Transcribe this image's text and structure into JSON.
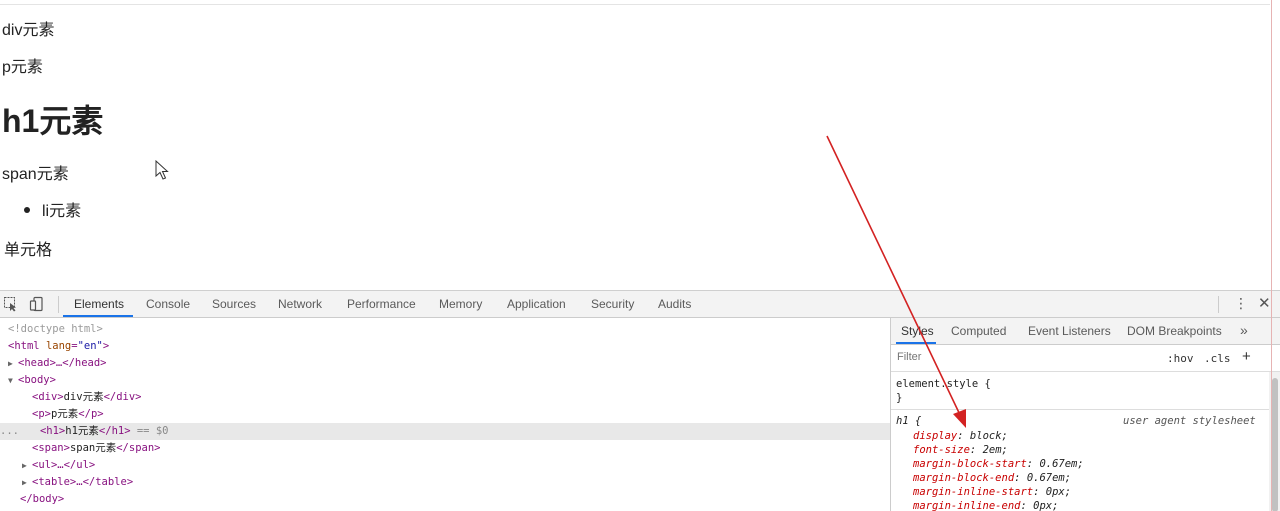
{
  "page": {
    "div_text": "div元素",
    "p_text": "p元素",
    "h1_text": "h1元素",
    "span_text": "span元素",
    "li_text": "li元素",
    "td_text": "单元格"
  },
  "devtools": {
    "tabs": [
      "Elements",
      "Console",
      "Sources",
      "Network",
      "Performance",
      "Memory",
      "Application",
      "Security",
      "Audits"
    ],
    "active_tab": "Elements",
    "dom": {
      "doctype": "<!doctype html>",
      "html_open_tag": "html",
      "html_attr": "lang",
      "html_attr_val": "\"en\"",
      "head": "<head>…</head>",
      "body_open": "<body>",
      "div_tag_open": "<div>",
      "div_text": "div元素",
      "div_tag_close": "</div>",
      "p_tag_open": "<p>",
      "p_text": "p元素",
      "p_tag_close": "</p>",
      "h1_tag_open": "<h1>",
      "h1_text": "h1元素",
      "h1_tag_close": "</h1>",
      "h1_marker": " == $0",
      "span_tag_open": "<span>",
      "span_text": "span元素",
      "span_tag_close": "</span>",
      "ul": "<ul>…</ul>",
      "table": "<table>…</table>",
      "body_close": "</body>",
      "ellipsis_marker": "..."
    },
    "styles_tabs": [
      "Styles",
      "Computed",
      "Event Listeners",
      "DOM Breakpoints"
    ],
    "styles_more": "»",
    "filter_placeholder": "Filter",
    "hov_label": ":hov",
    "cls_label": ".cls",
    "plus_label": "+",
    "element_style_open": "element.style {",
    "element_style_close": "}",
    "h1_selector": "h1 {",
    "ua_label": "user agent stylesheet",
    "declarations": [
      {
        "prop": "display",
        "value": "block;"
      },
      {
        "prop": "font-size",
        "value": "2em;"
      },
      {
        "prop": "margin-block-start",
        "value": "0.67em;"
      },
      {
        "prop": "margin-block-end",
        "value": "0.67em;"
      },
      {
        "prop": "margin-inline-start",
        "value": "0px;"
      },
      {
        "prop": "margin-inline-end",
        "value": "0px;"
      }
    ],
    "kebab_icon": "⋮",
    "close_icon": "✕"
  },
  "colors": {
    "accent_blue": "#1a73e8",
    "tag_purple": "#881280",
    "attr_brown": "#994500",
    "value_blue": "#1a1aa6",
    "prop_red": "#c80000",
    "annotation_red": "#d32222"
  }
}
